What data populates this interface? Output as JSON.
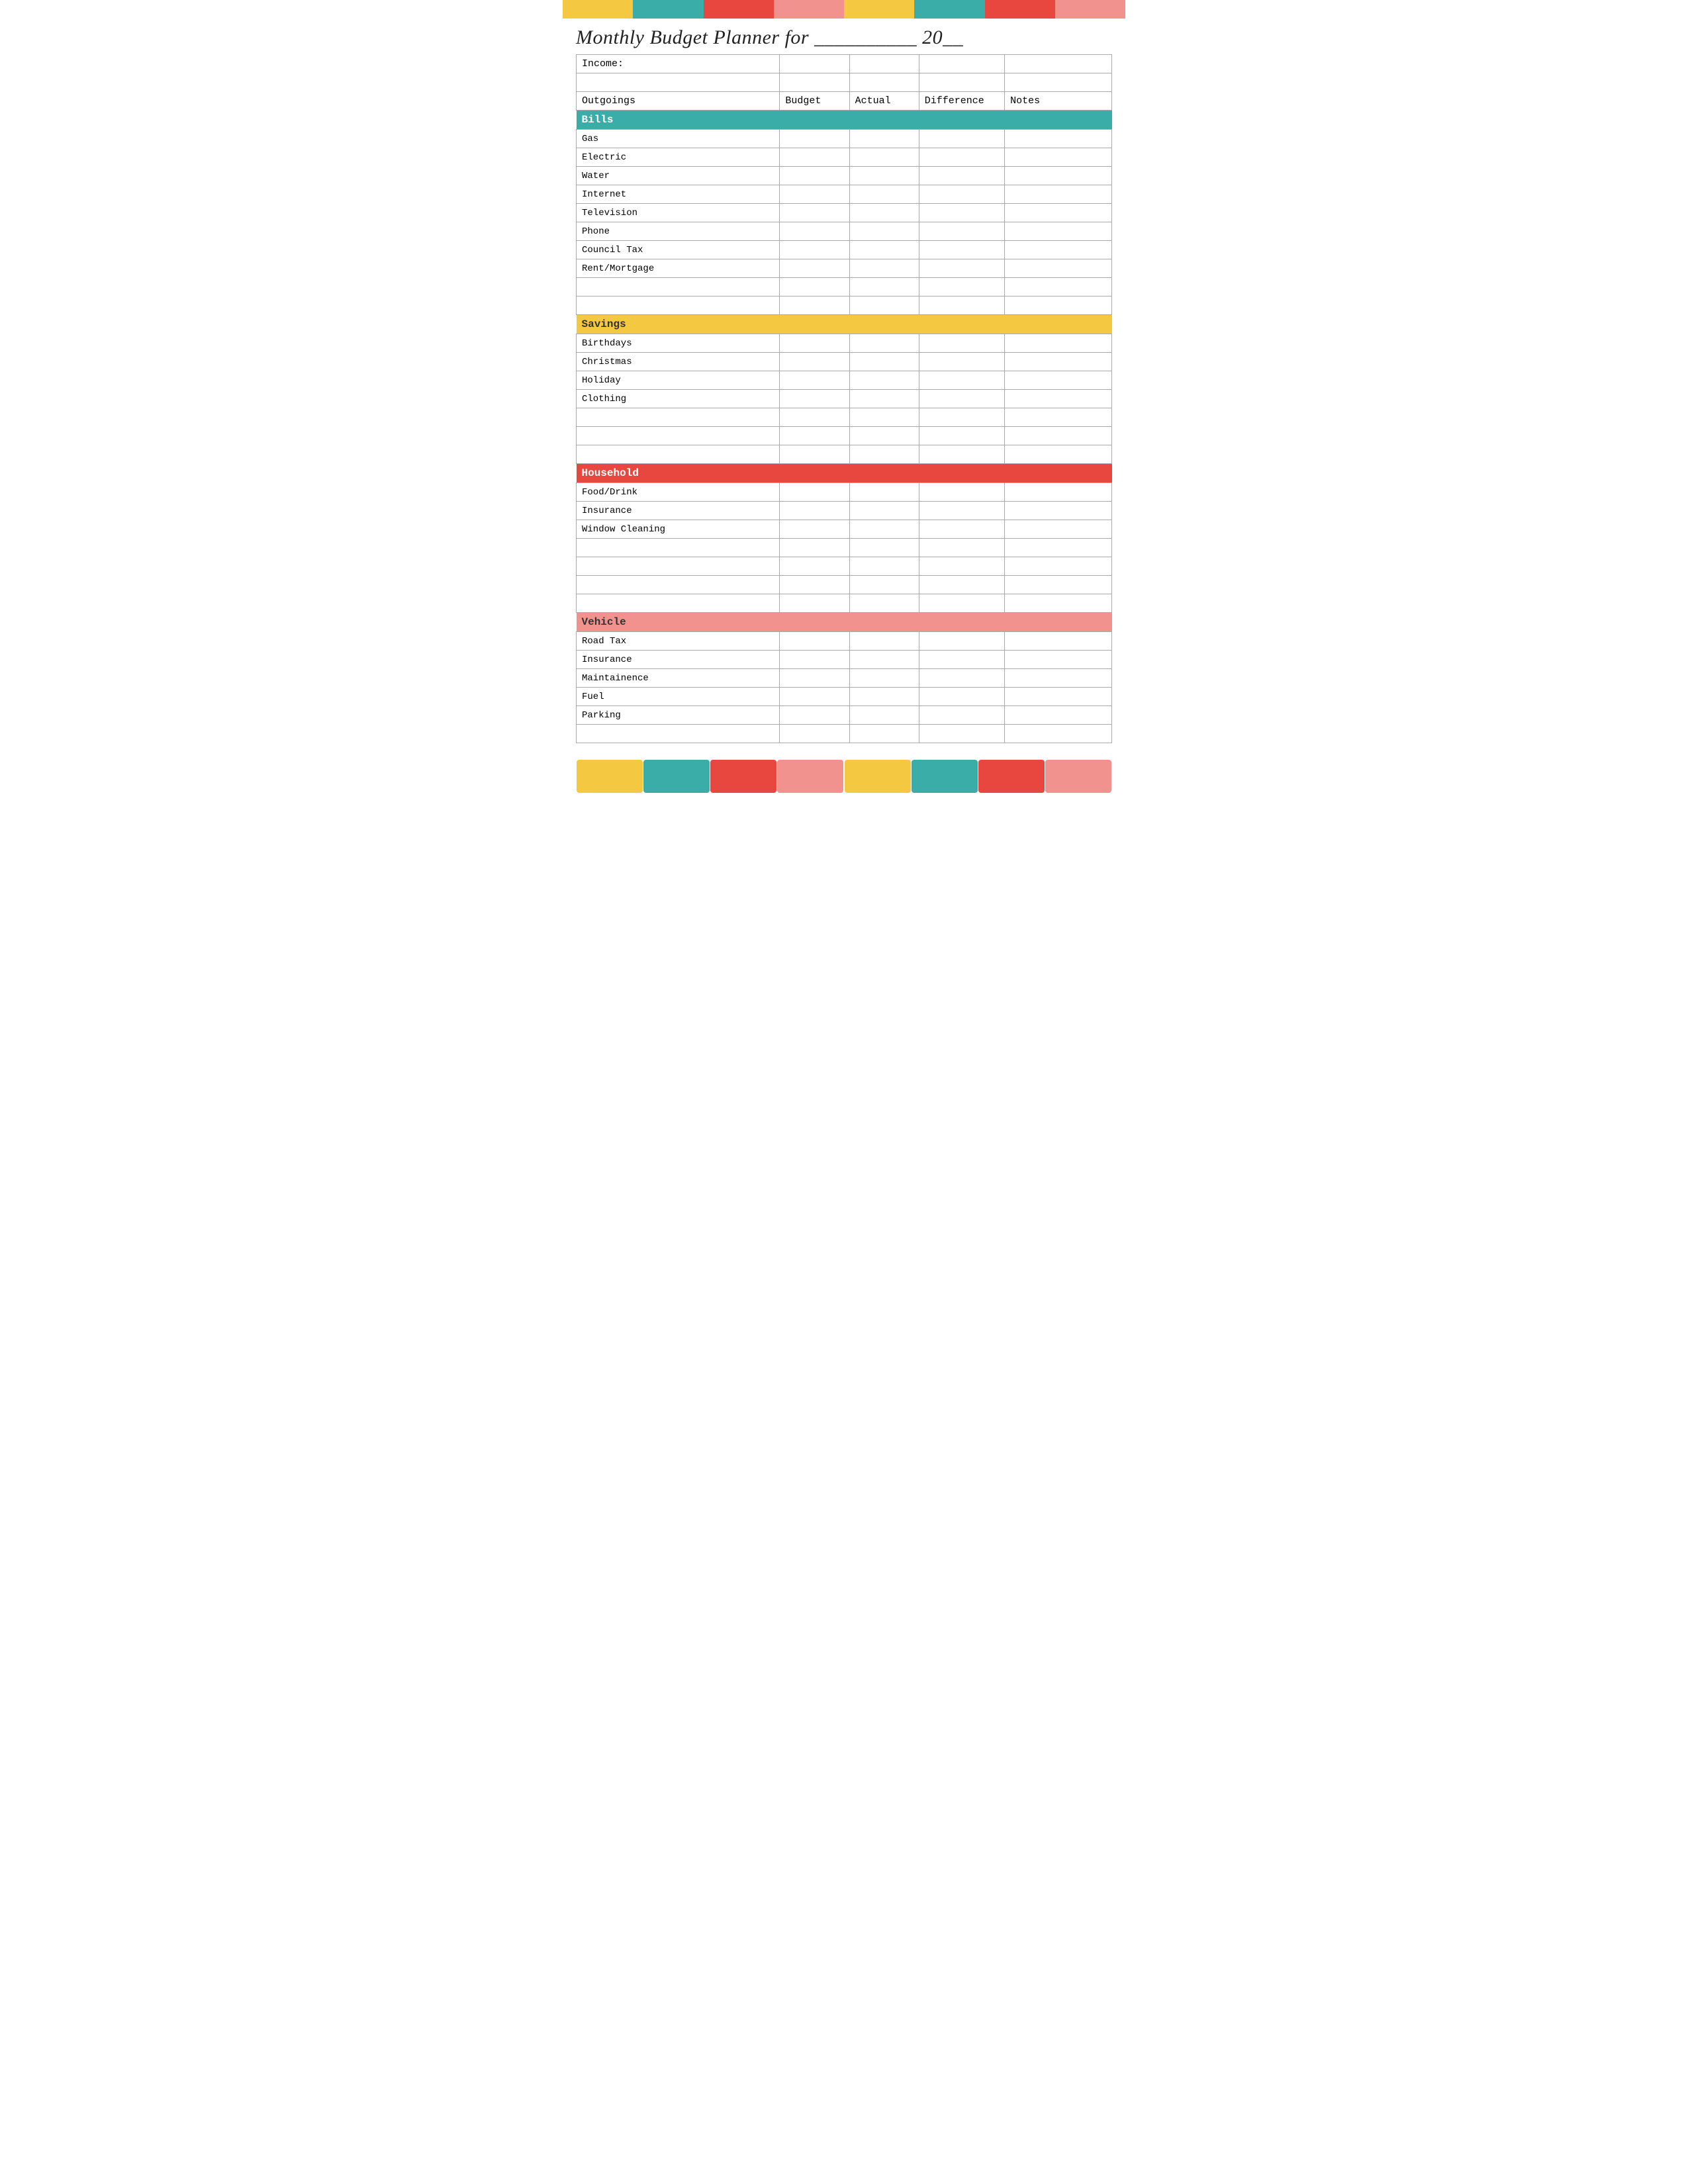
{
  "page": {
    "title": "Monthly Budget Planner for __________ 20__",
    "title_prefix": "Monthly Budget Planner for ",
    "title_line": "__________",
    "title_year": "20__"
  },
  "colors": {
    "yellow": "#F5C842",
    "teal": "#3AADA8",
    "red": "#E8473F",
    "pink": "#F2928E"
  },
  "top_bar": [
    "yellow",
    "teal",
    "red",
    "pink",
    "yellow",
    "teal",
    "red",
    "pink"
  ],
  "table": {
    "income_label": "Income:",
    "headers": {
      "outgoings": "Outgoings",
      "budget": "Budget",
      "actual": "Actual",
      "difference": "Difference",
      "notes": "Notes"
    },
    "sections": [
      {
        "id": "bills",
        "label": "Bills",
        "color": "teal",
        "items": [
          "Gas",
          "Electric",
          "Water",
          "Internet",
          "Television",
          "Phone",
          "Council Tax",
          "Rent/Mortgage",
          "",
          ""
        ]
      },
      {
        "id": "savings",
        "label": "Savings",
        "color": "yellow",
        "items": [
          "Birthdays",
          "Christmas",
          "Holiday",
          "Clothing",
          "",
          "",
          ""
        ]
      },
      {
        "id": "household",
        "label": "Household",
        "color": "red",
        "items": [
          "Food/Drink",
          "Insurance",
          "Window Cleaning",
          "",
          "",
          "",
          ""
        ]
      },
      {
        "id": "vehicle",
        "label": "Vehicle",
        "color": "pink",
        "items": [
          "Road Tax",
          "Insurance",
          "Maintainence",
          "Fuel",
          "Parking",
          ""
        ]
      }
    ]
  },
  "bottom_blocks": [
    "yellow",
    "teal",
    "red",
    "pink",
    "yellow",
    "teal",
    "red",
    "pink"
  ]
}
